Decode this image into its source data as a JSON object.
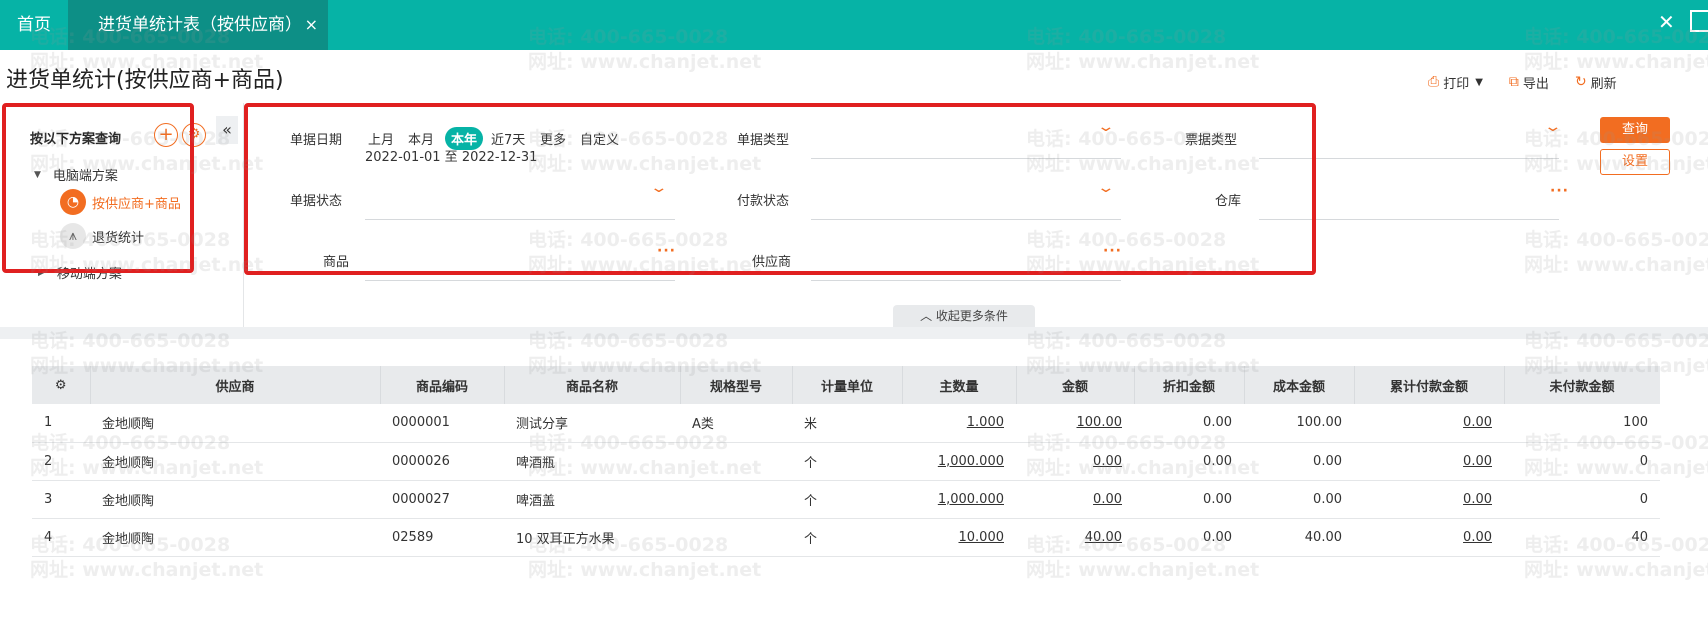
{
  "tabs": {
    "home": "首页",
    "active": "进货单统计表（按供应商）",
    "close": "×"
  },
  "window": {
    "close": "✕"
  },
  "page": {
    "title": "进货单统计(按供应商+商品)"
  },
  "actions": {
    "print": "打印",
    "export": "导出",
    "refresh": "刷新"
  },
  "schemes": {
    "title": "按以下方案查询",
    "group_pc": "电脑端方案",
    "item_active": "按供应商+商品",
    "item_return": "退货统计",
    "group_mobile": "移动端方案"
  },
  "filters": {
    "date_label": "单据日期",
    "date_chips": [
      "上月",
      "本月",
      "本年",
      "近7天",
      "更多",
      "自定义"
    ],
    "date_range": "2022-01-01 至 2022-12-31",
    "doc_type_label": "单据类型",
    "ticket_type_label": "票据类型",
    "doc_status_label": "单据状态",
    "pay_status_label": "付款状态",
    "warehouse_label": "仓库",
    "goods_label": "商品",
    "supplier_label": "供应商",
    "more_dots": "···",
    "query_button": "查询",
    "settings_button": "设置",
    "collapse_more": "收起更多条件"
  },
  "table": {
    "columns": [
      "供应商",
      "商品编码",
      "商品名称",
      "规格型号",
      "计量单位",
      "主数量",
      "金额",
      "折扣金额",
      "成本金额",
      "累计付款金额",
      "未付款金额"
    ],
    "rows": [
      [
        "1",
        "金地顺陶",
        "0000001",
        "测试分享",
        "A类",
        "米",
        "1.000",
        "100.00",
        "0.00",
        "100.00",
        "0.00",
        "100"
      ],
      [
        "2",
        "金地顺陶",
        "0000026",
        "啤酒瓶",
        "",
        "个",
        "1,000.000",
        "0.00",
        "0.00",
        "0.00",
        "0.00",
        "0"
      ],
      [
        "3",
        "金地顺陶",
        "0000027",
        "啤酒盖",
        "",
        "个",
        "1,000.000",
        "0.00",
        "0.00",
        "0.00",
        "0.00",
        "0"
      ],
      [
        "4",
        "金地顺陶",
        "02589",
        "10 双耳正方水果",
        "",
        "个",
        "10.000",
        "40.00",
        "0.00",
        "40.00",
        "0.00",
        "40"
      ]
    ]
  },
  "watermark": {
    "phone": "电话: 400-665-0028",
    "site": "网址: www.chanjet.net"
  },
  "colors": {
    "teal": "#06b3a6",
    "dark_teal": "#0d8f86",
    "orange": "#f26d21",
    "highlight_red": "#e02020"
  }
}
